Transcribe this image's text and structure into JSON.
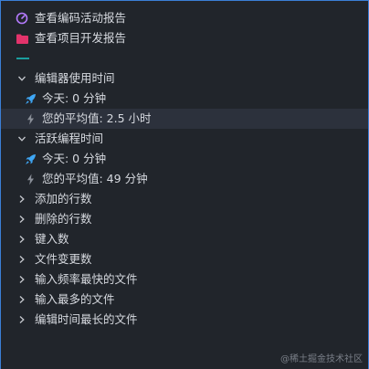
{
  "top_links": [
    {
      "label": "查看编码活动报告",
      "icon": "gauge-icon"
    },
    {
      "label": "查看项目开发报告",
      "icon": "folder-icon"
    }
  ],
  "sections": [
    {
      "title": "编辑器使用时间",
      "expanded": true,
      "items": [
        {
          "label": "今天:  0 分钟",
          "icon": "rocket-icon"
        },
        {
          "label": "您的平均值: 2.5 小时",
          "icon": "bolt-icon"
        }
      ]
    },
    {
      "title": "活跃编程时间",
      "expanded": true,
      "items": [
        {
          "label": "今天:  0 分钟",
          "icon": "rocket-icon"
        },
        {
          "label": "您的平均值: 49 分钟",
          "icon": "bolt-icon"
        }
      ]
    }
  ],
  "collapsed_sections": [
    "添加的行数",
    "删除的行数",
    "键入数",
    "文件变更数",
    "输入频率最快的文件",
    "输入最多的文件",
    "编辑时间最长的文件"
  ],
  "watermark": "@稀土掘金技术社区",
  "colors": {
    "accent_border": "#3b7fd6",
    "gauge": "#b57bff",
    "folder": "#e2336b",
    "teal": "#1a9e9e",
    "rocket": "#3fa7f5",
    "bolt": "#8a8f98"
  }
}
